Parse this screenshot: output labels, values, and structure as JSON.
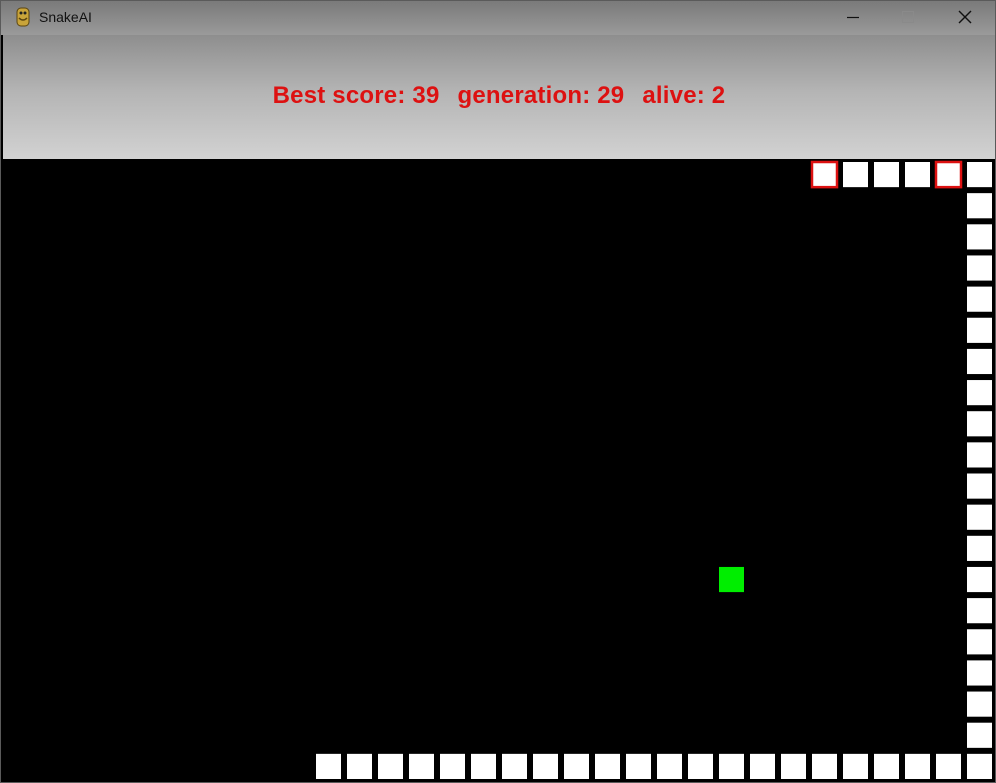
{
  "window": {
    "title": "SnakeAI",
    "icon": "python-icon",
    "controls": [
      "minimize-icon",
      "maximize-icon",
      "close-icon"
    ]
  },
  "hud": {
    "best_score_text": "Best score: 39",
    "generation_text": "generation: 29",
    "alive_text": "alive: 2",
    "color": "#dd1111"
  },
  "game": {
    "grid_columns": 32,
    "grid_rows": 20,
    "colors": {
      "background": "#000000",
      "snake_body": "#ffffff",
      "snake_head_outline": "#dd1111",
      "food": "#00ee00"
    },
    "food": [
      23,
      13
    ],
    "snakes": [
      {
        "segments": [
          [
            26,
            0
          ],
          [
            27,
            0
          ],
          [
            28,
            0
          ],
          [
            29,
            0
          ],
          [
            30,
            0
          ],
          [
            31,
            0
          ],
          [
            31,
            1
          ],
          [
            31,
            2
          ],
          [
            31,
            3
          ],
          [
            31,
            4
          ],
          [
            31,
            5
          ],
          [
            31,
            6
          ],
          [
            31,
            7
          ],
          [
            31,
            8
          ],
          [
            31,
            9
          ],
          [
            31,
            10
          ],
          [
            31,
            11
          ],
          [
            31,
            12
          ],
          [
            31,
            13
          ],
          [
            31,
            14
          ],
          [
            31,
            15
          ],
          [
            31,
            16
          ],
          [
            31,
            17
          ],
          [
            31,
            18
          ],
          [
            31,
            19
          ],
          [
            30,
            19
          ],
          [
            29,
            19
          ],
          [
            28,
            19
          ],
          [
            27,
            19
          ],
          [
            26,
            19
          ],
          [
            25,
            19
          ],
          [
            24,
            19
          ],
          [
            23,
            19
          ],
          [
            22,
            19
          ],
          [
            21,
            19
          ],
          [
            20,
            19
          ],
          [
            19,
            19
          ],
          [
            18,
            19
          ],
          [
            17,
            19
          ],
          [
            16,
            19
          ],
          [
            15,
            19
          ],
          [
            14,
            19
          ],
          [
            13,
            19
          ],
          [
            12,
            19
          ],
          [
            11,
            19
          ],
          [
            10,
            19
          ]
        ],
        "head_outlined": [
          [
            26,
            0
          ],
          [
            30,
            0
          ]
        ]
      }
    ]
  }
}
